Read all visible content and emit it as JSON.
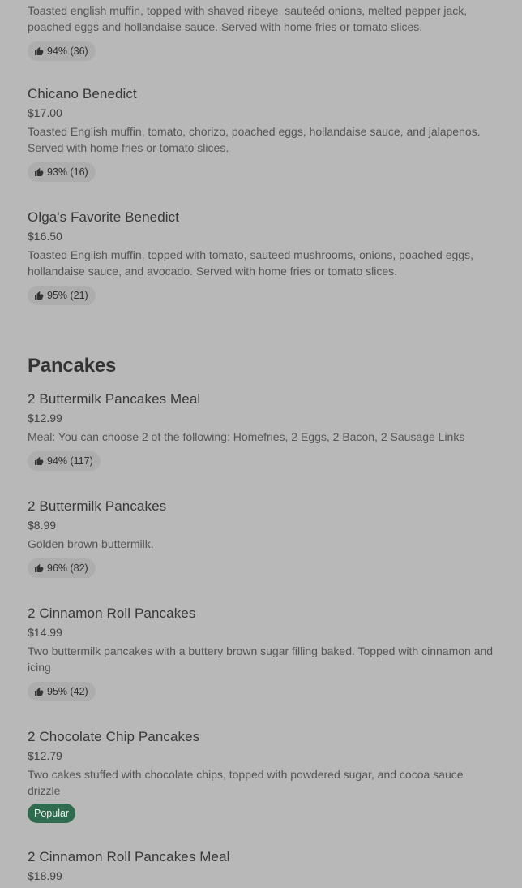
{
  "top_item": {
    "description": "Toasted english muffin, topped with shaved ribeye, sauteéd onions, melted pepper jack, poached eggs and hollandaise sauce. Served with home fries or tomato slices.",
    "rating": "94% (36)"
  },
  "items_benedict": [
    {
      "name": "Chicano Benedict",
      "price": "$17.00",
      "description": "Toasted English muffin, tomato, chorizo, poached eggs, hollandaise sauce, and jalapenos. Served with home fries or tomato slices.",
      "rating": "93% (16)"
    },
    {
      "name": "Olga's Favorite Benedict",
      "price": "$16.50",
      "description": "Toasted English muffin, topped with tomato, sauteed mushrooms, onions, poached eggs, hollandaise sauce, and avocado. Served with home fries or tomato slices.",
      "rating": "95% (21)"
    }
  ],
  "section": {
    "title": "Pancakes"
  },
  "items_pancakes": [
    {
      "name": "2 Buttermilk Pancakes Meal",
      "price": "$12.99",
      "description": "Meal: You can choose 2 of the following: Homefries, 2 Eggs, 2 Bacon, 2 Sausage Links",
      "rating": "94% (117)"
    },
    {
      "name": "2 Buttermilk Pancakes",
      "price": "$8.99",
      "description": "Golden brown buttermilk.",
      "rating": "96% (82)"
    },
    {
      "name": "2 Cinnamon Roll Pancakes",
      "price": "$14.99",
      "description": "Two buttermilk pancakes with a buttery brown sugar filling baked. Topped with cinnamon and icing",
      "rating": "95% (42)"
    },
    {
      "name": "2 Chocolate Chip Pancakes",
      "price": "$12.79",
      "description": "Two cakes stuffed with chocolate chips, topped with powdered sugar, and cocoa sauce drizzle",
      "badge": "Popular"
    },
    {
      "name": "2 Cinnamon Roll Pancakes Meal",
      "price": "$18.99"
    }
  ],
  "icons": {
    "rating": "thumbs-up-icon"
  },
  "colors": {
    "background": "#b8b8b8",
    "popular_badge": "#2f6b4f",
    "rating_pill": "#adadad"
  }
}
